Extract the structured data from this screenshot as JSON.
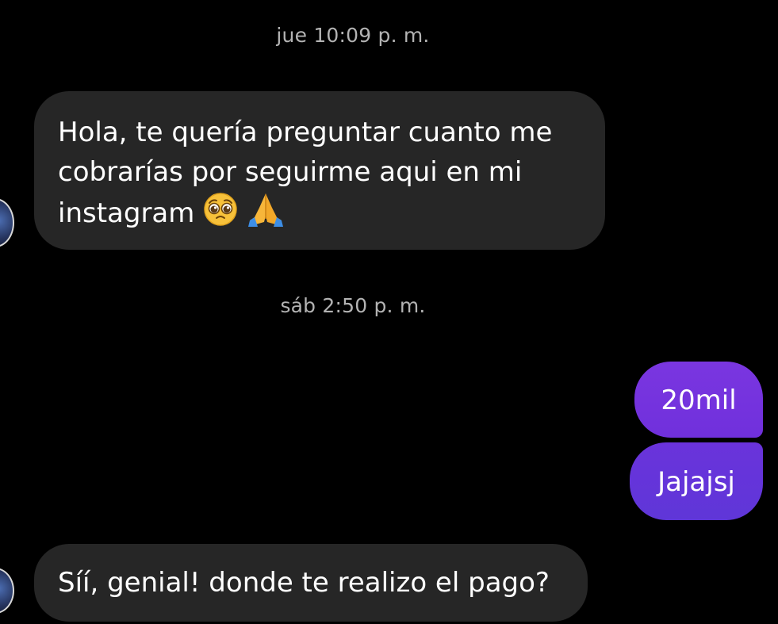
{
  "conversation": {
    "timestamps": [
      "jue 10:09 p. m.",
      "sáb 2:50 p. m."
    ],
    "messages": [
      {
        "sender": "other",
        "line1": "Hola, te quería preguntar cuanto me",
        "line2": "cobrarías por seguirme aqui en mi",
        "line3": "instagram",
        "emojis": [
          "pleading-face",
          "folded-hands"
        ]
      },
      {
        "sender": "me",
        "text": "20mil"
      },
      {
        "sender": "me",
        "text": "Jajajsj"
      },
      {
        "sender": "other",
        "text": "Síí, genial! donde te realizo el pago?"
      }
    ]
  },
  "colors": {
    "background": "#000000",
    "incoming_bubble": "#262626",
    "outgoing_bubble_top": "#7a36e0",
    "outgoing_bubble_bottom": "#5f36d8",
    "timestamp_text": "#b3b3b3"
  }
}
